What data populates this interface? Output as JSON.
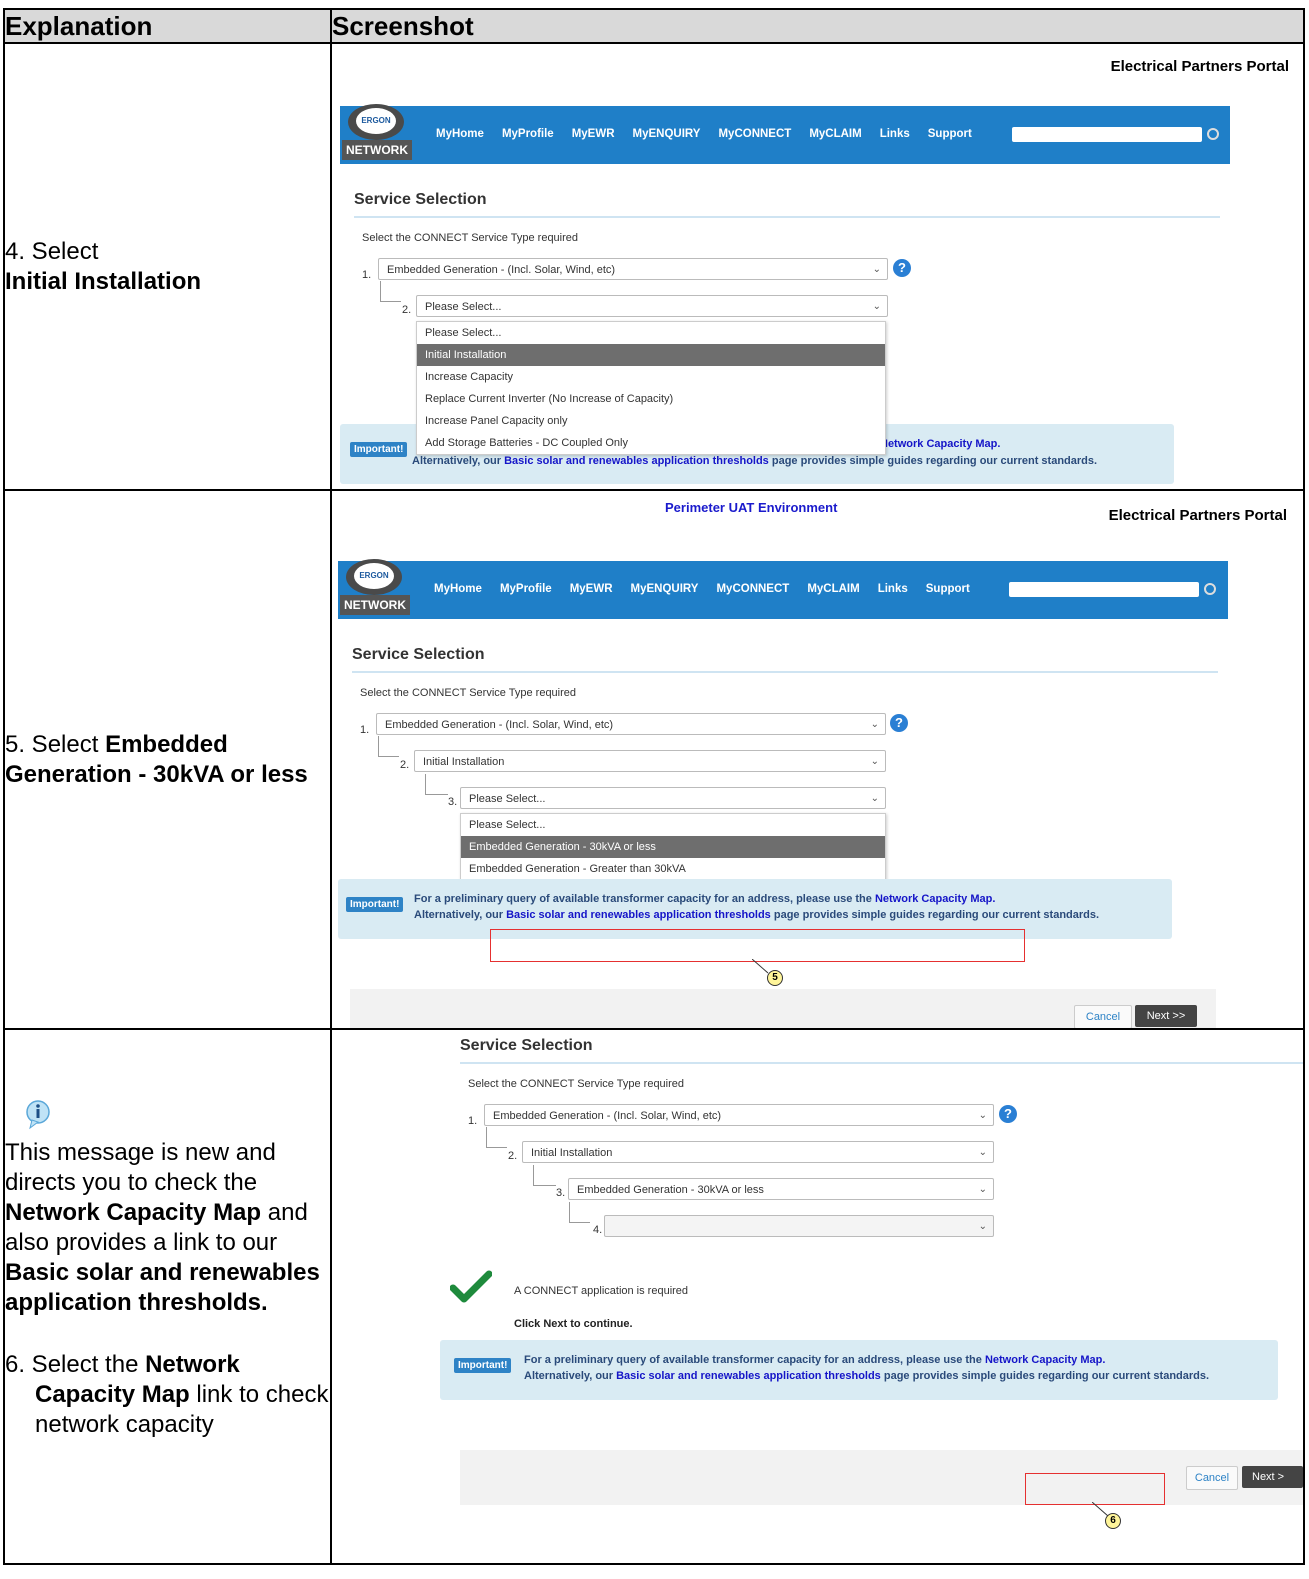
{
  "header": {
    "col1": "Explanation",
    "col2": "Screenshot"
  },
  "rows": [
    {
      "step_prefix": "4. Select ",
      "step_bold": "Initial Installation"
    },
    {
      "step_prefix": "5. Select ",
      "step_bold": "Embedded Generation - 30kVA or less"
    },
    {
      "note_a": "This message is new and directs you to check the ",
      "note_b": "Network Capacity Map",
      "note_c": " and also provides a link to our ",
      "note_d": "Basic solar and renewables application thresholds.",
      "step_prefix": "6. Select the ",
      "step_bold": "Network Capacity Map",
      "step_suffix": " link to check network capacity"
    }
  ],
  "portal": {
    "title": "Electrical Partners Portal",
    "uat": "Perimeter UAT Environment",
    "logo_top": "ERGON",
    "logo_sub": "ENERGY",
    "logo_net": "NETWORK",
    "nav": [
      "MyHome",
      "MyProfile",
      "MyEWR",
      "MyENQUIRY",
      "MyCONNECT",
      "MyCLAIM",
      "Links",
      "Support"
    ],
    "section_title": "Service Selection",
    "prompt": "Select the CONNECT Service Type required",
    "sel1": "Embedded Generation - (Incl. Solar, Wind, etc)",
    "sel2_placeholder": "Please Select...",
    "sel2_value": "Initial Installation",
    "sel3_placeholder": "Please Select...",
    "sel3_value": "Embedded Generation - 30kVA or less",
    "n1": "1.",
    "n2": "2.",
    "n3": "3.",
    "n4": "4.",
    "dropdown2": [
      "Please Select...",
      "Initial Installation",
      "Increase Capacity",
      "Replace Current Inverter (No Increase of Capacity)",
      "Increase Panel Capacity only",
      "Add Storage Batteries - DC Coupled Only"
    ],
    "dropdown3": [
      "Please Select...",
      "Embedded Generation - 30kVA or less",
      "Embedded Generation - Greater than 30kVA"
    ],
    "important": "Important!",
    "info_line1_a": "For a preliminary query of available transformer capacity for an address, please use the ",
    "info_link1": "Network Capacity Map.",
    "info_line1_partial": "Network Capacity Map.",
    "info_line2_a": "Alternatively, our ",
    "info_link2": "Basic solar and renewables application thresholds",
    "info_line2_b": " page provides simple guides regarding our current standards.",
    "cancel": "Cancel",
    "next": "Next >>",
    "next_cut": "Next >",
    "connect_required": "A CONNECT application is required",
    "click_next": "Click Next to continue.",
    "callout5": "5",
    "callout6": "6",
    "help": "?"
  },
  "colors": {
    "nav": "#1f7fc8",
    "info_bg": "#d9ebf3",
    "badge": "#2e83c6",
    "highlight": "#6e6e6e",
    "red": "#e53030",
    "check": "#1e8a3c"
  }
}
